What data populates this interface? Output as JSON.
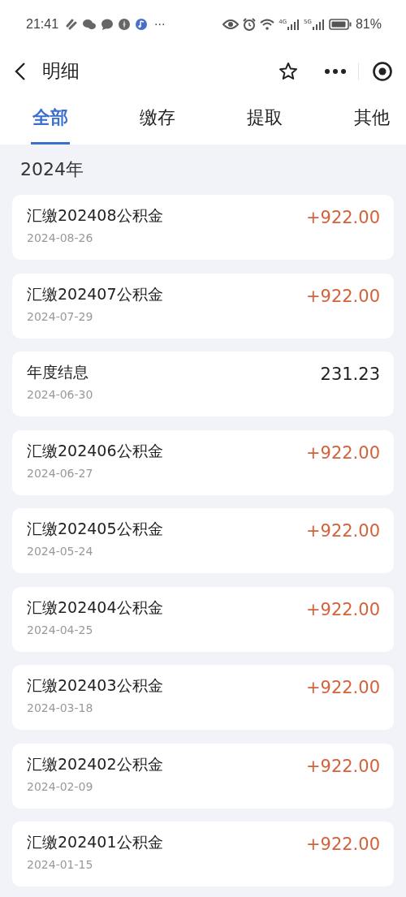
{
  "status_bar": {
    "time": "21:41",
    "more": "···",
    "battery_percent": "81%",
    "network_1": "4G",
    "network_2": "5G"
  },
  "header": {
    "title": "明细"
  },
  "tabs": [
    {
      "label": "全部",
      "selected": true
    },
    {
      "label": "缴存",
      "selected": false
    },
    {
      "label": "提取",
      "selected": false
    },
    {
      "label": "其他",
      "selected": false
    }
  ],
  "year": "2024年",
  "records": [
    {
      "title": "汇缴202408公积金",
      "date": "2024-08-26",
      "amount": "+922.00",
      "kind": "deposit"
    },
    {
      "title": "汇缴202407公积金",
      "date": "2024-07-29",
      "amount": "+922.00",
      "kind": "deposit"
    },
    {
      "title": "年度结息",
      "date": "2024-06-30",
      "amount": "231.23",
      "kind": "interest"
    },
    {
      "title": "汇缴202406公积金",
      "date": "2024-06-27",
      "amount": "+922.00",
      "kind": "deposit"
    },
    {
      "title": "汇缴202405公积金",
      "date": "2024-05-24",
      "amount": "+922.00",
      "kind": "deposit"
    },
    {
      "title": "汇缴202404公积金",
      "date": "2024-04-25",
      "amount": "+922.00",
      "kind": "deposit"
    },
    {
      "title": "汇缴202403公积金",
      "date": "2024-03-18",
      "amount": "+922.00",
      "kind": "deposit"
    },
    {
      "title": "汇缴202402公积金",
      "date": "2024-02-09",
      "amount": "+922.00",
      "kind": "deposit"
    },
    {
      "title": "汇缴202401公积金",
      "date": "2024-01-15",
      "amount": "+922.00",
      "kind": "deposit"
    }
  ]
}
